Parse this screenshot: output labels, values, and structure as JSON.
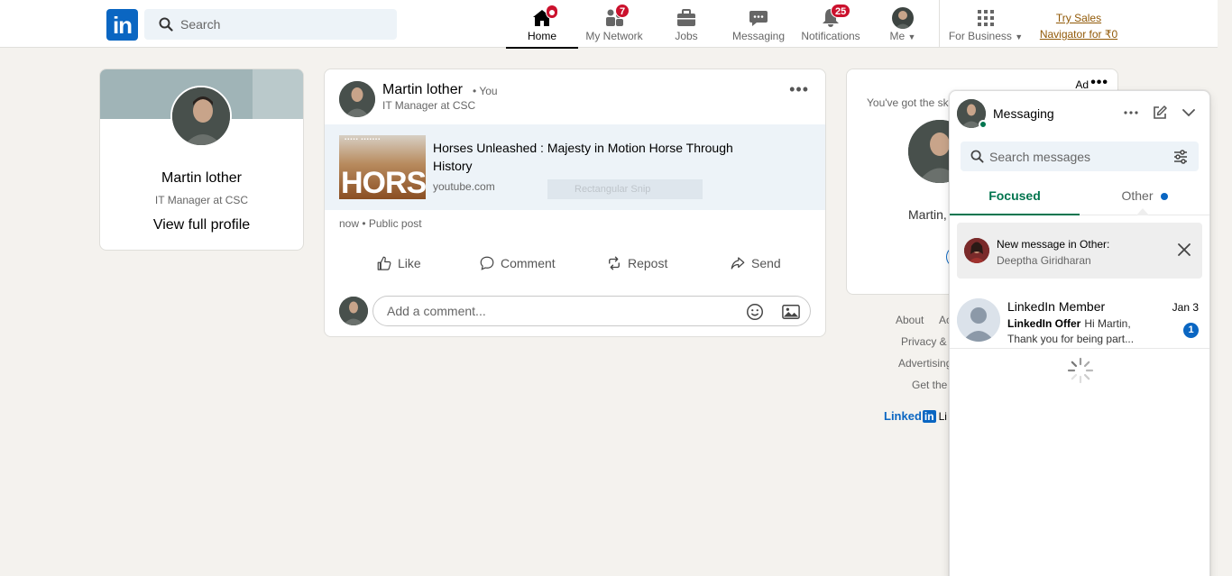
{
  "search": {
    "placeholder": "Search"
  },
  "nav": {
    "home": "Home",
    "network": "My Network",
    "network_badge": "7",
    "jobs": "Jobs",
    "messaging": "Messaging",
    "notifications": "Notifications",
    "notifications_badge": "25",
    "me": "Me",
    "business": "For Business",
    "try_sales_line1": "Try Sales",
    "try_sales_line2": "Navigator for ₹0"
  },
  "profile": {
    "name": "Martin lother",
    "title": "IT Manager at CSC",
    "link": "View full profile"
  },
  "post": {
    "author": "Martin lother",
    "you_tag": "• You",
    "subtitle": "IT Manager at CSC",
    "link_title": "Horses Unleashed : Majesty in Motion Horse Through History",
    "link_domain": "youtube.com",
    "thumb_word": "HORSE",
    "ghost_text": "Rectangular Snip",
    "meta": "now • Public post",
    "actions": {
      "like": "Like",
      "comment": "Comment",
      "repost": "Repost",
      "send": "Send"
    },
    "comment_placeholder": "Add a comment..."
  },
  "ad": {
    "label": "Ad",
    "text": "You've got the ski",
    "name": "Martin,"
  },
  "footer": {
    "about": "About",
    "ac": "Ac",
    "privacy": "Privacy &",
    "advertising": "Advertising",
    "get": "Get the",
    "brand": "Linked",
    "brand_in": "in",
    "brand_rest": "Li"
  },
  "messaging": {
    "title": "Messaging",
    "search_placeholder": "Search messages",
    "tabs": [
      {
        "label": "Focused"
      },
      {
        "label": "Other"
      }
    ],
    "notice": {
      "title": "New message in Other:",
      "sender": "Deeptha Giridharan"
    },
    "conversations": [
      {
        "name": "LinkedIn Member",
        "date": "Jan 3",
        "tag": "LinkedIn Offer",
        "preview": "Hi Martin, Thank you for being part...",
        "unread": "1"
      }
    ]
  },
  "colors": {
    "brand": "#0a66c2",
    "badge": "#cb112d",
    "focused_tab": "#01754f",
    "premium_link": "#915907"
  }
}
